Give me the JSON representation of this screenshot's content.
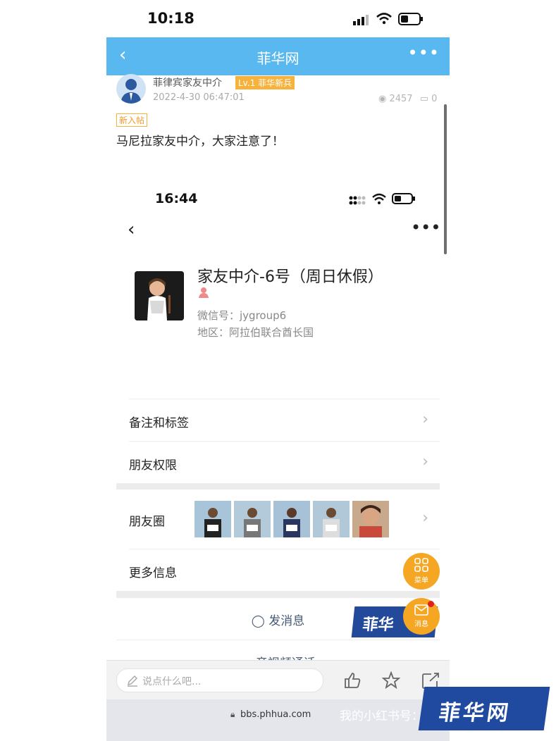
{
  "status_bar": {
    "time": "10:18"
  },
  "header": {
    "back_icon": "chevron-left-icon",
    "title": "菲华网",
    "more_icon": "more-horizontal-icon"
  },
  "post": {
    "author": "菲律宾家友中介",
    "level_badge": "Lv.1 菲华新兵",
    "date": "2022-4-30 06:47:01",
    "views": "2457",
    "comments": "0",
    "new_tag": "新入帖",
    "title": "马尼拉家友中介，大家注意了！"
  },
  "embedded_screenshot": {
    "time": "16:44",
    "profile_name": "家友中介-6号（周日休假）",
    "wechat_id": "微信号：jygroup6",
    "region": "地区：阿拉伯联合酋长国",
    "rows": [
      {
        "label": "备注和标签"
      },
      {
        "label": "朋友权限"
      },
      {
        "label": "朋友圈"
      },
      {
        "label": "更多信息"
      }
    ],
    "send_message": "发消息",
    "video_call": "音视频通话",
    "watermark": "菲华"
  },
  "fabs": {
    "menu_label": "菜单",
    "message_label": "消息",
    "accent": "#f5a623"
  },
  "bottom_bar": {
    "comment_placeholder": "说点什么吧..."
  },
  "browser": {
    "url": "bbs.phhua.com"
  },
  "watermark": {
    "text": "我的小红书号：",
    "logo": "菲华网"
  },
  "colors": {
    "header_bg": "#59b8f0",
    "level_badge": "#f6b23a",
    "logo_blue": "#1f4aa0"
  }
}
